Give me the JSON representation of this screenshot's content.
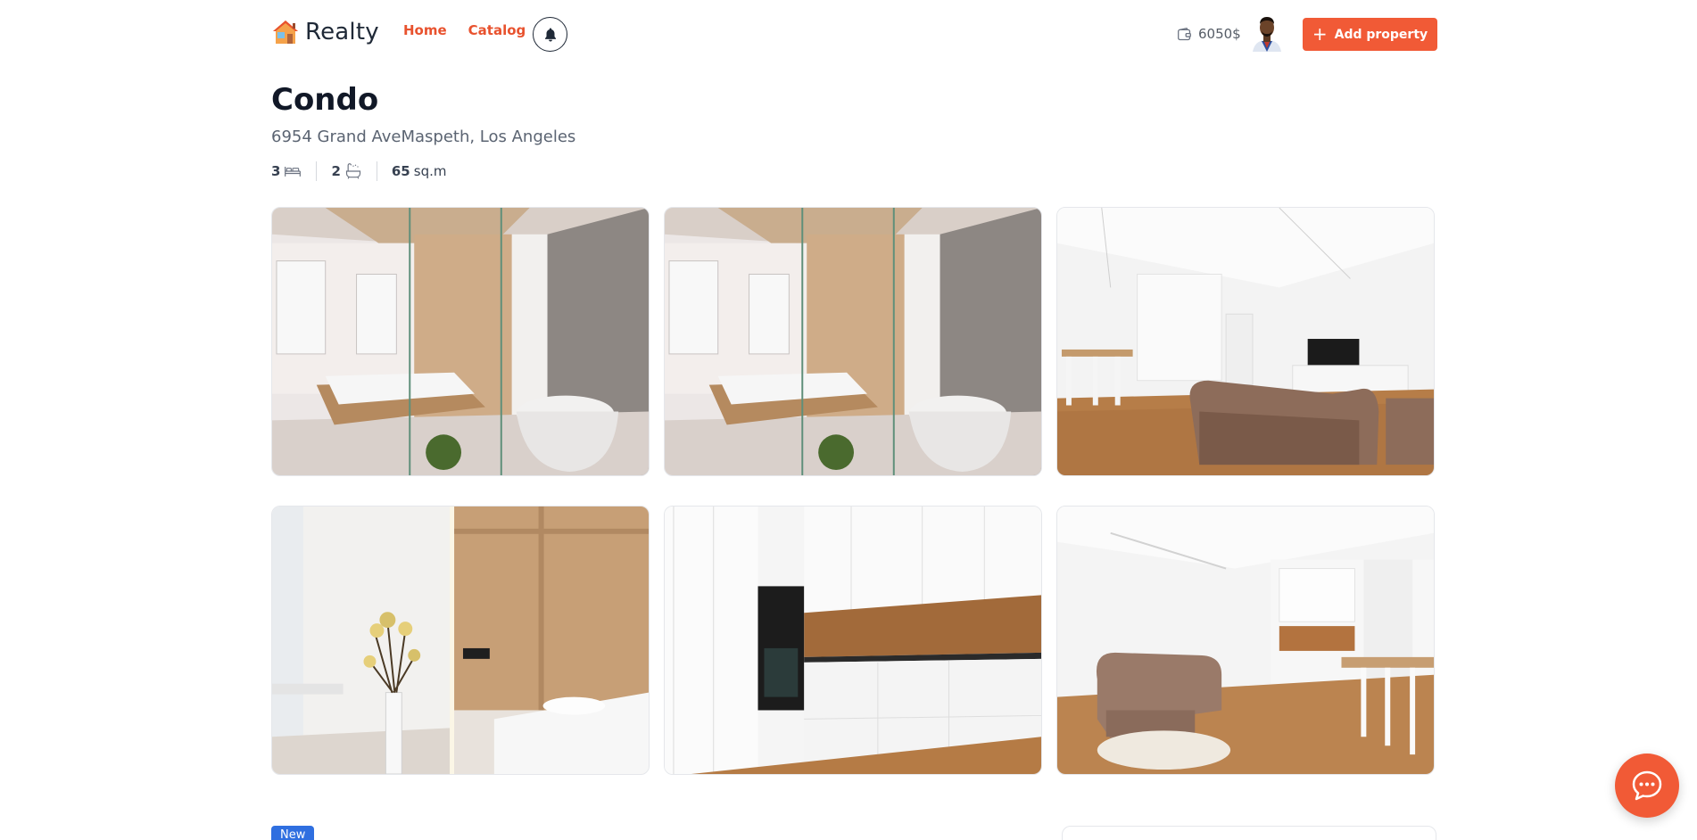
{
  "header": {
    "brand": "Realty",
    "nav": {
      "home": "Home",
      "catalog": "Catalog"
    },
    "wallet_balance": "6050$",
    "add_property_label": "Add property",
    "accent_color": "#f15a36"
  },
  "listing": {
    "title": "Condo",
    "address": "6954 Grand AveMaspeth, Los Angeles",
    "bedrooms": "3",
    "bathrooms": "2",
    "area_value": "65",
    "area_unit": "sq.m"
  },
  "gallery": {
    "photos": [
      "bedroom-bathroom",
      "bedroom-bathroom",
      "living-dining",
      "bedroom-wood-wall",
      "kitchen",
      "living-room-sofa"
    ]
  },
  "bottom": {
    "badge": "New"
  },
  "icons": {
    "logo": "house-logo-icon",
    "bell": "bell-icon",
    "wallet": "wallet-icon",
    "bed": "bed-icon",
    "bath": "bath-icon",
    "plus": "plus-icon",
    "chat": "chat-icon"
  }
}
